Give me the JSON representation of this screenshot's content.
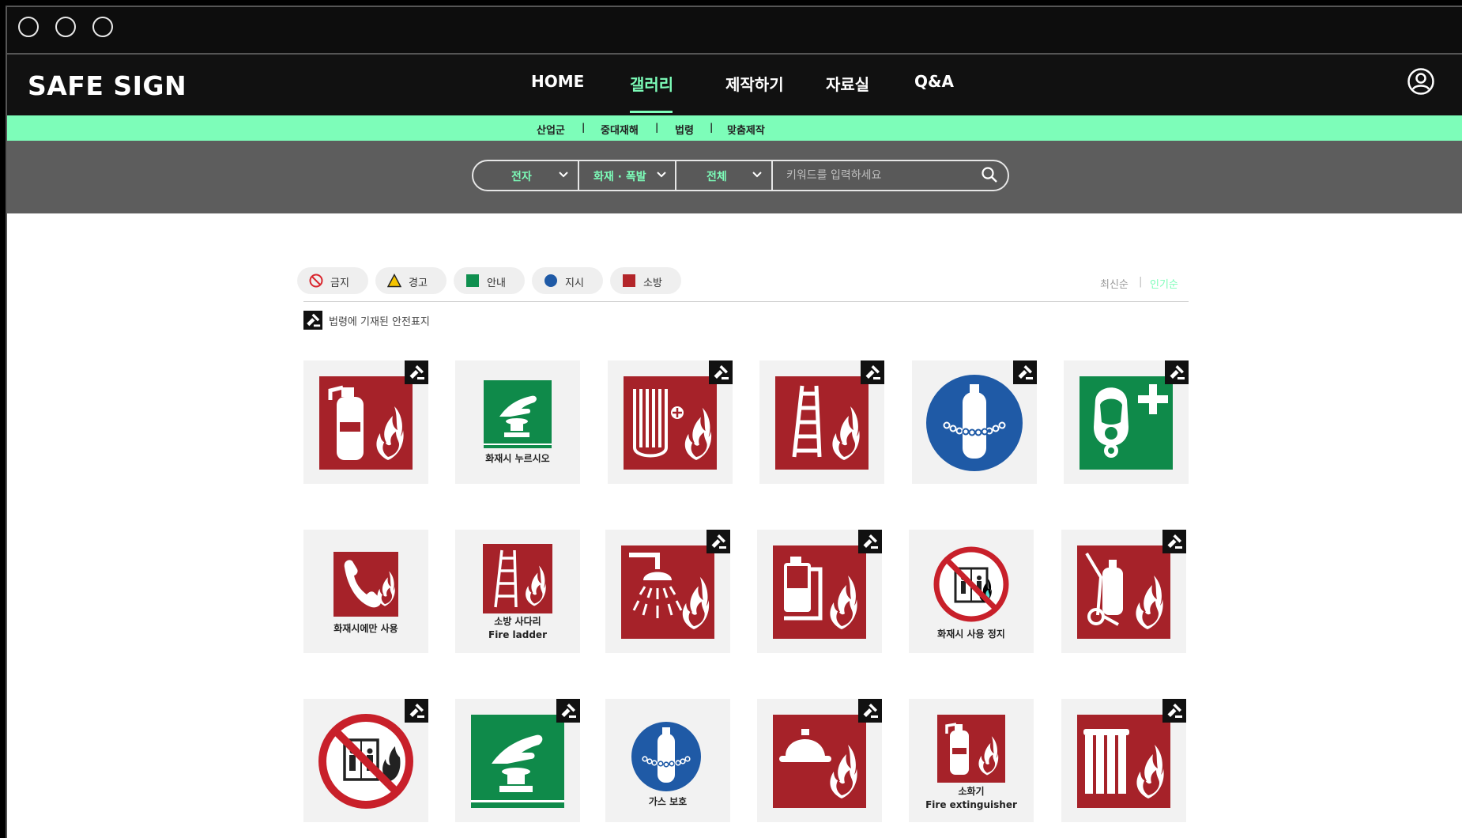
{
  "brand": {
    "logo": "SAFE SIGN"
  },
  "nav": {
    "items": [
      {
        "label": "HOME"
      },
      {
        "label": "갤러리",
        "active": true
      },
      {
        "label": "제작하기"
      },
      {
        "label": "자료실"
      },
      {
        "label": "Q&A"
      }
    ],
    "user_icon": "user-circle-icon"
  },
  "subnav": {
    "items": [
      "산업군",
      "중대재해",
      "법령",
      "맞춤제작"
    ]
  },
  "filters": {
    "select1": "전자",
    "select2": "화재 · 폭발",
    "select3": "전체",
    "search_placeholder": "키워드를 입력하세요",
    "search_icon": "search-icon"
  },
  "categories": [
    {
      "label": "금지",
      "icon": "prohibition-icon",
      "color": "#d9262e"
    },
    {
      "label": "경고",
      "icon": "warning-triangle-icon",
      "color": "#f5c400"
    },
    {
      "label": "안내",
      "icon": "green-square-icon",
      "color": "#0f8f4f"
    },
    {
      "label": "지시",
      "icon": "blue-circle-icon",
      "color": "#1f5aa6"
    },
    {
      "label": "소방",
      "icon": "red-square-icon",
      "color": "#b3262a"
    }
  ],
  "sort": {
    "latest": "최신순",
    "popular": "인기순",
    "active": "popular"
  },
  "legal_note": "법령에 기재된 안전표지",
  "colors": {
    "accent": "#7dfdb9",
    "fire_red": "#a62229",
    "safe_green": "#0f8a4a",
    "mandatory_blue": "#1f5aa6",
    "prohibit_red": "#c8202a"
  },
  "cards": [
    {
      "name": "fire-extinguisher-sign",
      "caption": "",
      "legal": true
    },
    {
      "name": "press-in-fire-sign",
      "caption": "화재시 누르시오",
      "legal": false
    },
    {
      "name": "fire-hose-sign",
      "caption": "",
      "legal": true
    },
    {
      "name": "fire-ladder-sign",
      "caption": "",
      "legal": true
    },
    {
      "name": "gas-cylinder-chain-sign",
      "caption": "",
      "legal": true
    },
    {
      "name": "breathing-apparatus-sign",
      "caption": "",
      "legal": true
    },
    {
      "name": "fire-phone-sign",
      "caption": "화재시에만 사용",
      "legal": false
    },
    {
      "name": "fire-ladder-caption-sign",
      "caption": "소방 사다리",
      "caption2": "Fire ladder",
      "legal": false
    },
    {
      "name": "sprinkler-sign",
      "caption": "",
      "legal": true
    },
    {
      "name": "fire-pump-sign",
      "caption": "",
      "legal": true
    },
    {
      "name": "no-elevator-in-fire-caption-sign",
      "caption": "화재시 사용 정지",
      "legal": false
    },
    {
      "name": "wheeled-extinguisher-sign",
      "caption": "",
      "legal": true
    },
    {
      "name": "no-elevator-in-fire-sign",
      "caption": "",
      "legal": true
    },
    {
      "name": "press-button-green-sign",
      "caption": "",
      "legal": true
    },
    {
      "name": "gas-protection-sign",
      "caption": "가스 보호",
      "legal": false
    },
    {
      "name": "fire-helmet-sign",
      "caption": "",
      "legal": true
    },
    {
      "name": "extinguisher-caption-sign",
      "caption": "소화기",
      "caption2": "Fire extinguisher",
      "legal": false
    },
    {
      "name": "fire-cabinet-sign",
      "caption": "",
      "legal": true
    }
  ]
}
